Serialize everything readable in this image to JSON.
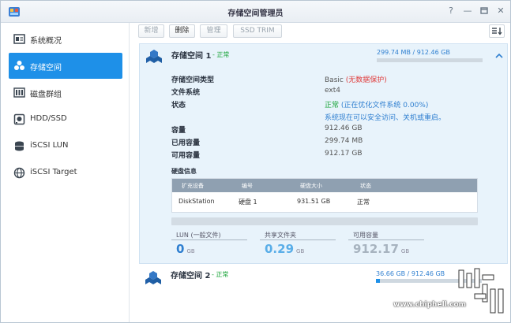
{
  "window": {
    "title": "存储空间管理员"
  },
  "sidebar": {
    "items": [
      {
        "label": "系统概况",
        "icon": "overview-icon"
      },
      {
        "label": "存储空间",
        "icon": "storage-icon",
        "active": true
      },
      {
        "label": "磁盘群组",
        "icon": "disk-group-icon"
      },
      {
        "label": "HDD/SSD",
        "icon": "hdd-icon"
      },
      {
        "label": "iSCSI LUN",
        "icon": "iscsi-lun-icon"
      },
      {
        "label": "iSCSI Target",
        "icon": "iscsi-target-icon"
      }
    ]
  },
  "toolbar": {
    "create_label": "新增",
    "delete_label": "删除",
    "manage_label": "管理",
    "ssd_trim_label": "SSD TRIM"
  },
  "volume1": {
    "name": "存储空间 1",
    "status": "- 正常",
    "usage_text": "299.74 MB / 912.46 GB",
    "usage_fraction": 0.0003,
    "details": {
      "type_label": "存储空间类型",
      "type_value": "Basic",
      "type_note": "(无数据保护)",
      "fs_label": "文件系统",
      "fs_value": "ext4",
      "state_label": "状态",
      "state_value": "正常",
      "state_note": "(正在优化文件系统 0.00%)",
      "state_note2": "系统现在可以安全访问、关机或重启。",
      "capacity_label": "容量",
      "capacity_value": "912.46 GB",
      "used_label": "已用容量",
      "used_value": "299.74 MB",
      "avail_label": "可用容量",
      "avail_value": "912.17 GB"
    },
    "disk_info": {
      "title": "硬盘信息",
      "headers": [
        "扩充设备",
        "编号",
        "硬盘大小",
        "状态"
      ],
      "rows": [
        {
          "device": "DiskStation",
          "number": "硬盘 1",
          "size": "931.51 GB",
          "status": "正常"
        }
      ]
    },
    "stats": [
      {
        "label": "LUN (一般文件)",
        "value": "0",
        "unit": "GB",
        "color": "#2f7fd0"
      },
      {
        "label": "共享文件夹",
        "value": "0.29",
        "unit": "GB",
        "color": "#5aaee8"
      },
      {
        "label": "可用容量",
        "value": "912.17",
        "unit": "GB",
        "color": "#a7b3bf"
      }
    ]
  },
  "volume2": {
    "name": "存储空间 2",
    "status": "- 正常",
    "usage_text": "36.66 GB / 912.46 GB",
    "usage_fraction": 0.04
  },
  "watermark": {
    "text": "www.chiphell.com",
    "logo_text": "chip hell"
  },
  "colors": {
    "accent": "#1e90e8",
    "ok": "#1aa43a",
    "warn": "#e03a3a",
    "link": "#2f7fd0"
  }
}
